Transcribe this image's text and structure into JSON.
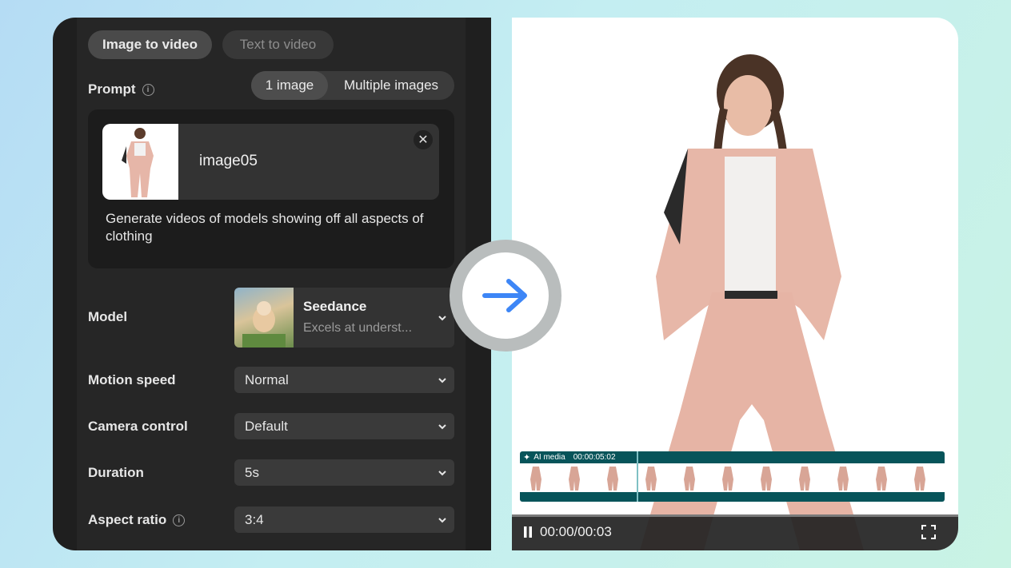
{
  "modes": {
    "image_to_video": "Image to video",
    "text_to_video": "Text to video"
  },
  "prompt": {
    "label": "Prompt",
    "image_count_options": [
      "1 image",
      "Multiple images"
    ],
    "uploaded_name": "image05",
    "text": "Generate videos of models showing off all aspects of clothing"
  },
  "model": {
    "label": "Model",
    "name": "Seedance",
    "description": "Excels at underst..."
  },
  "motion_speed": {
    "label": "Motion speed",
    "value": "Normal"
  },
  "camera_control": {
    "label": "Camera control",
    "value": "Default"
  },
  "duration": {
    "label": "Duration",
    "value": "5s"
  },
  "aspect_ratio": {
    "label": "Aspect ratio",
    "value": "3:4"
  },
  "timeline": {
    "title": "AI media",
    "duration": "00:00:05:02"
  },
  "player": {
    "time": "00:00/00:03"
  },
  "colors": {
    "accent_blue": "#3d86f6",
    "timeline_teal": "#07545a"
  },
  "icons": [
    "info-icon",
    "close-icon",
    "chevron-down-icon",
    "arrow-right-icon",
    "sparkle-icon",
    "pause-icon",
    "fullscreen-icon"
  ]
}
